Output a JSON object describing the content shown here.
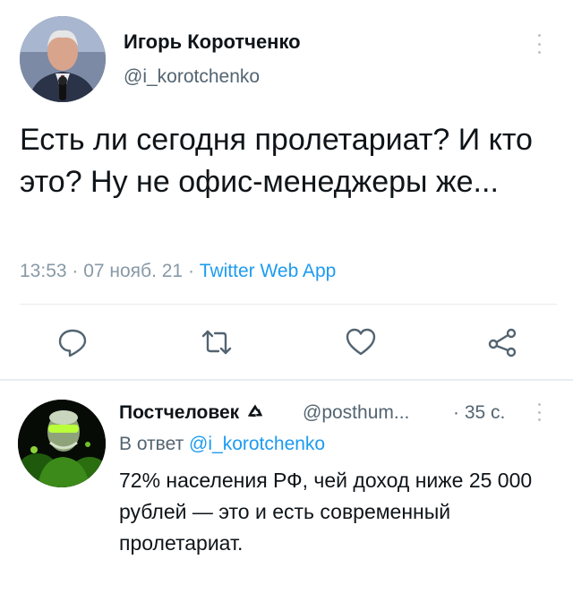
{
  "main_tweet": {
    "author_name": "Игорь Коротченко",
    "author_handle": "@i_korotchenko",
    "text": "Есть ли сегодня пролетариат? И кто это? Ну не офис-менеджеры же...",
    "timestamp": "13:53 · 07 нояб. 21 · ",
    "source_app": "Twitter Web App",
    "actions": [
      {
        "icon": "reply-icon"
      },
      {
        "icon": "retweet-icon"
      },
      {
        "icon": "like-icon"
      },
      {
        "icon": "share-icon"
      }
    ]
  },
  "reply": {
    "author_name": "Постчеловек",
    "badge_icon": "recycle-icon",
    "author_handle": "@posthum...",
    "time": "· 35 с.",
    "reply_to_prefix": "В ответ ",
    "reply_to_handle": "@i_korotchenko",
    "text": "72% населения РФ, чей доход ниже 25 000 рублей — это и есть современный пролетариат."
  },
  "colors": {
    "accent": "#1d9bf0",
    "secondary_text": "#536471",
    "divider": "#e6ecf0"
  }
}
